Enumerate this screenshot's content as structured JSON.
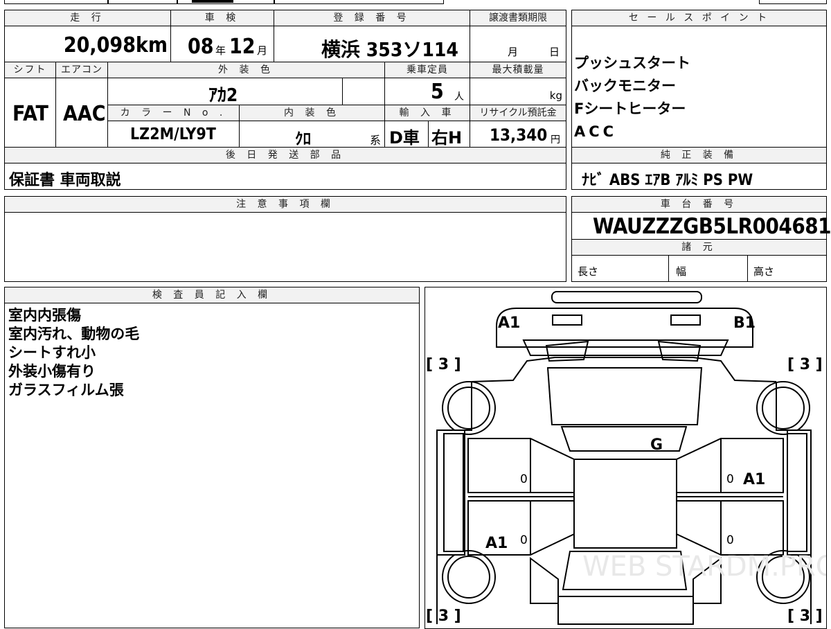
{
  "header_row": {
    "mileage_label": "走 行",
    "inspection_label": "車 検",
    "registration_label": "登 録 番 号",
    "transfer_deadline_label": "譲渡書類期限",
    "sales_points_label": "セ ー ル ス ポ イ ン ト"
  },
  "mileage": {
    "value": "20,098",
    "unit": "km"
  },
  "inspection": {
    "year": "08",
    "year_unit": "年",
    "month": "12",
    "month_unit": "月"
  },
  "registration": {
    "value": "横浜 353ソ114"
  },
  "transfer_deadline": {
    "month_unit": "月",
    "day_unit": "日"
  },
  "row2": {
    "shift_label": "シフト",
    "aircon_label": "エアコン",
    "exterior_color_label": "外 装 色",
    "capacity_label": "乗車定員",
    "max_load_label": "最大積載量"
  },
  "shift": "FAT",
  "aircon": "AAC",
  "exterior_color": "ｱｶ2",
  "capacity": {
    "value": "5",
    "unit": "人"
  },
  "max_load": {
    "unit": "kg"
  },
  "row3": {
    "color_no_label": "カ ラ ー N o .",
    "interior_color_label": "内 装 色",
    "import_label": "輸 入 車",
    "recycle_label": "リサイクル預託金"
  },
  "color_no": "LZ2M/LY9T",
  "interior_color": {
    "value": "ｸﾛ",
    "suffix": "系"
  },
  "import": {
    "type": "D車",
    "steering": "右H"
  },
  "recycle": {
    "value": "13,340",
    "unit": "円"
  },
  "sales_points": [
    "プッシュスタート",
    "バックモニター",
    "Fシートヒーター",
    "ACC"
  ],
  "later_parts": {
    "label": "後 日 発 送 部 品",
    "value": "保証書 車両取説"
  },
  "genuine_equipment": {
    "label": "純 正 装 備",
    "value": "ﾅﾋﾞ ABS ｴｱB ｱﾙﾐ PS PW"
  },
  "notes": {
    "label": "注 意 事 項 欄"
  },
  "chassis": {
    "label": "車 台 番 号",
    "value": "WAUZZZGB5LR004681"
  },
  "specs": {
    "label": "諸 元",
    "length": "長さ",
    "width": "幅",
    "height": "高さ"
  },
  "inspector": {
    "label": "検 査 員 記 入 欄",
    "lines": [
      "室内内張傷",
      "室内汚れ、動物の毛",
      "シートすれ小",
      "外装小傷有り",
      "ガラスフィルム張"
    ]
  },
  "diagram": {
    "marks": [
      "A1",
      "B1",
      "G",
      "A1",
      "A1"
    ],
    "tire_marks": [
      "[ 3 ]",
      "[ 3 ]",
      "[ 3 ]",
      "[ 3 ]"
    ],
    "zero_marks": [
      "0",
      "0",
      "0",
      "0"
    ],
    "watermark": "WEB STARDM.PRO"
  }
}
